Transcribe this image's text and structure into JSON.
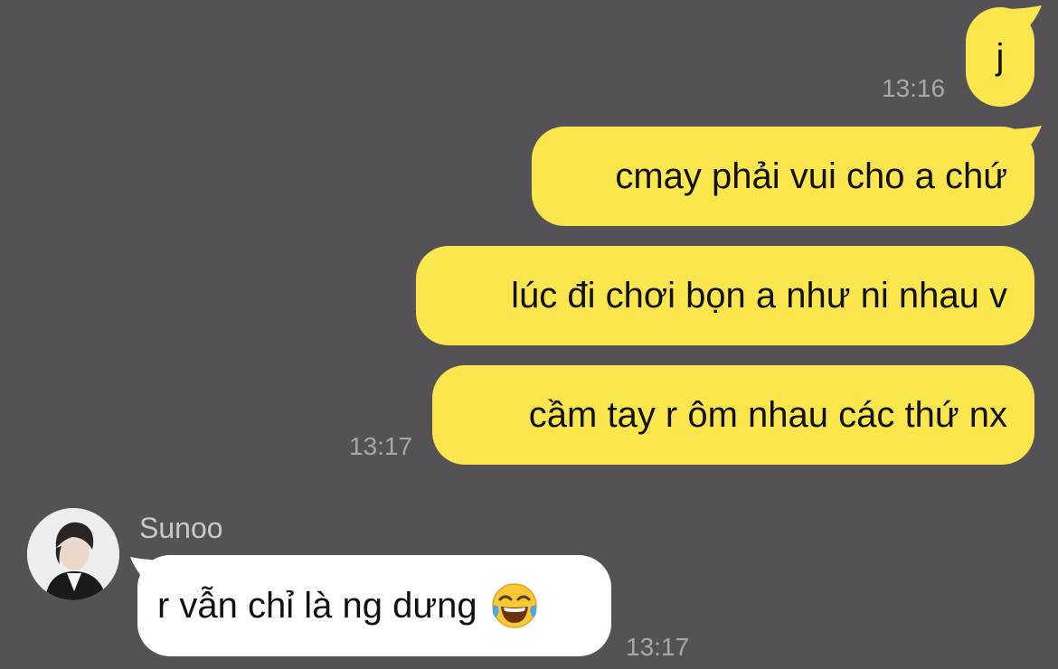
{
  "chat": {
    "colors": {
      "background": "#545254",
      "outgoing_bubble": "#fbe74d",
      "incoming_bubble": "#ffffff",
      "timestamp": "#a9a7a9"
    },
    "messages": [
      {
        "direction": "outgoing",
        "text": "j",
        "time": "13:16"
      },
      {
        "direction": "outgoing",
        "text": "cmay phải vui cho a chứ"
      },
      {
        "direction": "outgoing",
        "text": "lúc đi chơi bọn a như ni nhau v"
      },
      {
        "direction": "outgoing",
        "text": "cầm tay r ôm nhau các thứ nx",
        "time": "13:17"
      },
      {
        "direction": "incoming",
        "sender": "Sunoo",
        "avatar_icon": "profile-photo",
        "text": "r vẫn chỉ là ng dưng",
        "emoji": "face-with-tears-of-joy-icon",
        "time": "13:17"
      }
    ]
  }
}
